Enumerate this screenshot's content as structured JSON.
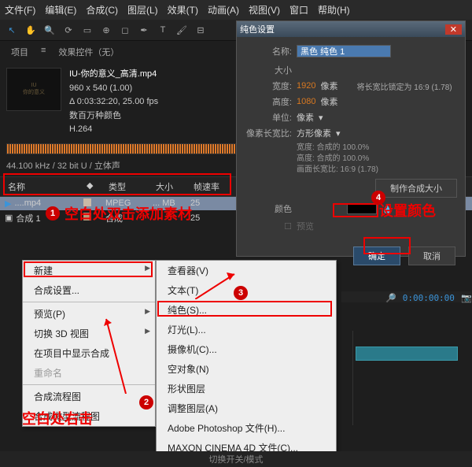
{
  "menubar": [
    "文件(F)",
    "编辑(E)",
    "合成(C)",
    "图层(L)",
    "效果(T)",
    "动画(A)",
    "视图(V)",
    "窗口",
    "帮助(H)"
  ],
  "project_tabs": {
    "project": "项目",
    "effect_controls": "效果控件（无）"
  },
  "source": {
    "title": "IU-你的意义_高清.mp4",
    "dims": "960 x 540 (1.00)",
    "dur": "Δ 0:03:32:20, 25.00 fps",
    "colors": "数百万种颜色",
    "codec": "H.264",
    "audio": "44.100 kHz / 32 bit U / 立体声"
  },
  "list": {
    "headers": {
      "name": "名称",
      "tag": "",
      "type": "类型",
      "size": "大小",
      "fps": "帧速率"
    },
    "rows": [
      {
        "name": "....mp4",
        "type": "MPEG",
        "size": "... MB",
        "fps": "25"
      },
      {
        "name": "合成 1",
        "type": "合成",
        "size": "",
        "fps": "25"
      }
    ]
  },
  "annotations": {
    "dbl_click": "空白处双击添加素材",
    "right_click": "空白处右击",
    "set_color": "设置颜色"
  },
  "solid_dialog": {
    "title": "纯色设置",
    "name_label": "名称:",
    "name_value": "黑色 纯色 1",
    "size_label": "大小",
    "width_label": "宽度:",
    "width_value": "1920",
    "px": "像素",
    "height_label": "高度:",
    "height_value": "1080",
    "lock_aspect": "将长宽比锁定为 16:9 (1.78)",
    "unit_label": "单位:",
    "unit_value": "像素",
    "par_label": "像素长宽比:",
    "par_value": "方形像素",
    "w_pct": "宽度: 合成的 100.0%",
    "h_pct": "高度: 合成的 100.0%",
    "frame_aspect": "画面长宽比: 16:9 (1.78)",
    "make_comp": "制作合成大小",
    "color_label": "颜色",
    "preview": "预览",
    "ok": "确定",
    "cancel": "取消"
  },
  "ctx_main": [
    {
      "label": "新建",
      "sub": true
    },
    {
      "label": "合成设置..."
    },
    {
      "sep": true
    },
    {
      "label": "预览(P)",
      "sub": true
    },
    {
      "label": "切换 3D 视图",
      "sub": true
    },
    {
      "label": "在项目中显示合成"
    },
    {
      "label": "重命名",
      "disabled": true
    },
    {
      "sep": true
    },
    {
      "label": "合成流程图"
    },
    {
      "label": "合成微型流程图"
    }
  ],
  "ctx_sub": [
    "查看器(V)",
    "文本(T)",
    "纯色(S)...",
    "灯光(L)...",
    "摄像机(C)...",
    "空对象(N)",
    "形状图层",
    "调整图层(A)",
    "Adobe Photoshop 文件(H)...",
    "MAXON CINEMA 4D 文件(C)..."
  ],
  "timeline": {
    "timecode": "0:00:00:00",
    "switch_label": "切换开关/模式"
  }
}
